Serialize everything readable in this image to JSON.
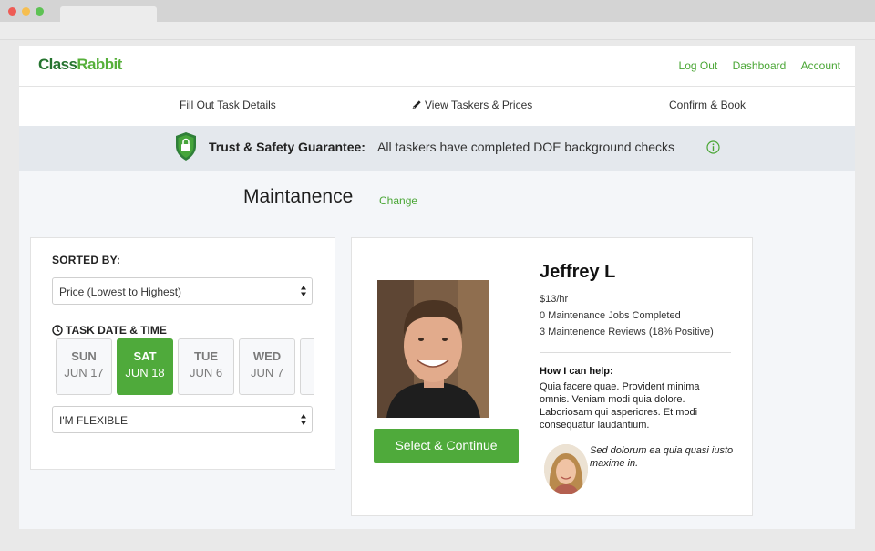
{
  "brand": {
    "logo_part1": "Class",
    "logo_part2": "Rabbit"
  },
  "nav": {
    "links": [
      "Log Out",
      "Dashboard",
      "Account"
    ]
  },
  "steps": [
    "Fill Out Task Details",
    "View Taskers & Prices",
    "Confirm & Book"
  ],
  "banner": {
    "title": "Trust & Safety Guarantee:",
    "text": "All taskers have completed DOE background checks"
  },
  "task": {
    "title": "Maintanence",
    "change_label": "Change"
  },
  "filters": {
    "sorted_label": "SORTED BY:",
    "sort_value": "Price (Lowest to Highest)",
    "date_label": "TASK DATE & TIME",
    "days": [
      {
        "name": "SUN",
        "date": "JUN 17",
        "selected": false
      },
      {
        "name": "SAT",
        "date": "JUN 18",
        "selected": true
      },
      {
        "name": "TUE",
        "date": "JUN 6",
        "selected": false
      },
      {
        "name": "WED",
        "date": "JUN 7",
        "selected": false
      }
    ],
    "time_value": "I'M FLEXIBLE"
  },
  "tasker": {
    "name": "Jeffrey L",
    "rate": "$13/hr",
    "jobs": "0 Maintenance Jobs Completed",
    "reviews": "3 Maintenence Reviews (18% Positive)",
    "help_heading": "How I can help:",
    "help_text": "Quia facere quae. Provident minima omnis. Veniam modi quia dolore. Laboriosam qui asperiores. Et modi consequatur laudantium.",
    "select_label": "Select & Continue",
    "review_quote": "Sed dolorum ea quia quasi iusto maxime in."
  },
  "colors": {
    "accent": "#4faa3b",
    "logo_dark": "#25742f",
    "banner_bg": "#e4e8ed"
  }
}
